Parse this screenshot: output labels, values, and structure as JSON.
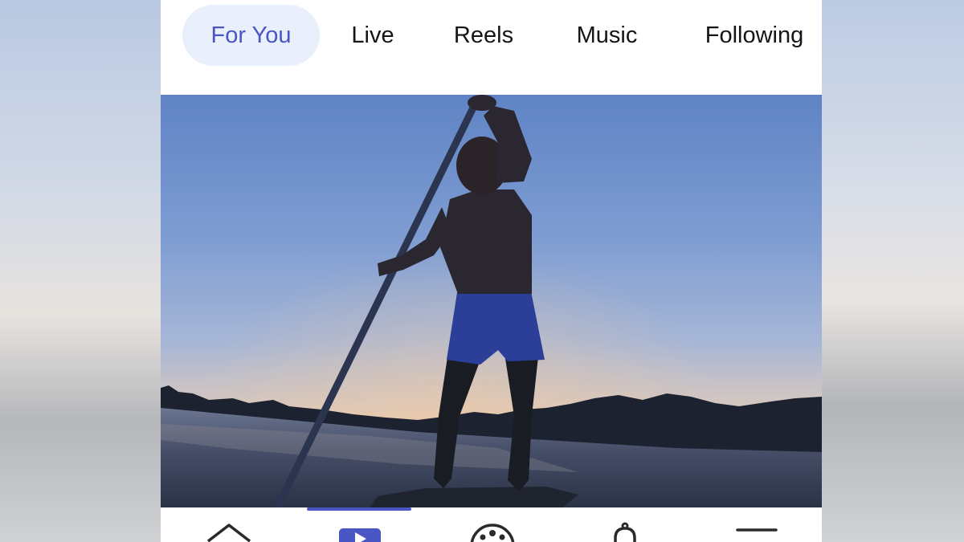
{
  "tabs": [
    {
      "label": "For You",
      "active": true
    },
    {
      "label": "Live",
      "active": false
    },
    {
      "label": "Reels",
      "active": false
    },
    {
      "label": "Music",
      "active": false
    },
    {
      "label": "Following",
      "active": false
    }
  ],
  "colors": {
    "accent": "#4a56c4",
    "active_tab_bg": "#e9f0fb",
    "text": "#151515"
  },
  "media": {
    "icon": "video-frame"
  },
  "bottom_nav": [
    {
      "icon": "home-icon",
      "active": false
    },
    {
      "icon": "video-play-icon",
      "active": true
    },
    {
      "icon": "groups-icon",
      "active": false
    },
    {
      "icon": "notifications-bell-icon",
      "active": false
    },
    {
      "icon": "menu-icon",
      "active": false
    }
  ]
}
